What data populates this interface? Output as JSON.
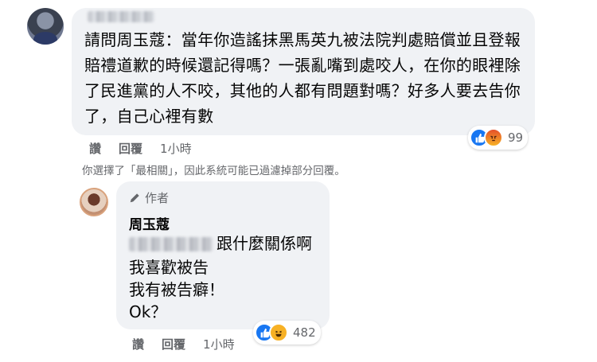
{
  "comment": {
    "text": "請問周玉蔻：當年你造謠抹黑馬英九被法院判處賠償並且登報賠禮道歉的時候還記得嗎？一張亂嘴到處咬人，在你的眼裡除了民進黨的人不咬，其他的人都有問題對嗎？好多人要去告你了，自己心裡有數",
    "reaction_count": "99",
    "like_label": "讚",
    "reply_label": "回覆",
    "time": "1小時",
    "reaction_icons": [
      "like-icon",
      "angry-icon"
    ]
  },
  "filter_notice": "你選擇了「最相關」，因此系統可能已過濾掉部分回覆。",
  "reply": {
    "badge": "作者",
    "author": "周玉蔻",
    "line1_suffix": "跟什麼關係啊",
    "line2": "我喜歡被告",
    "line3": "我有被告癖！",
    "line4": "Ok？",
    "reaction_count": "482",
    "like_label": "讚",
    "reply_label": "回覆",
    "time": "1小時",
    "reaction_icons": [
      "like-icon",
      "haha-icon"
    ]
  }
}
